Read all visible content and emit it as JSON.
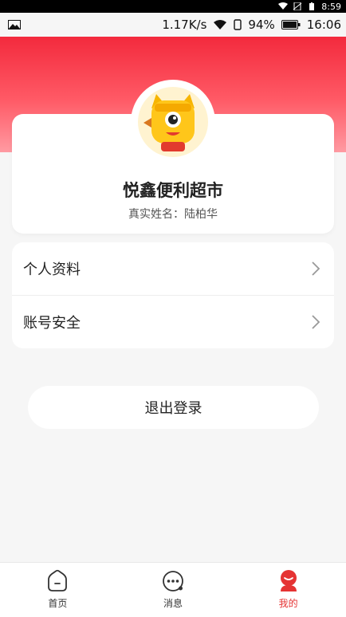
{
  "status_bar": {
    "time": "8:59"
  },
  "app_bar": {
    "speed": "1.17K/s",
    "battery": "94%",
    "time": "16:06"
  },
  "profile": {
    "shop_name": "悦鑫便利超市",
    "real_name_label": "真实姓名：",
    "real_name": "陆柏华"
  },
  "menu": {
    "items": [
      {
        "label": "个人资料"
      },
      {
        "label": "账号安全"
      }
    ]
  },
  "logout_label": "退出登录",
  "tabs": [
    {
      "label": "首页",
      "icon": "home-icon",
      "active": false
    },
    {
      "label": "消息",
      "icon": "message-icon",
      "active": false
    },
    {
      "label": "我的",
      "icon": "profile-icon",
      "active": true
    }
  ],
  "colors": {
    "accent": "#e53333",
    "hero": "#f32a3d"
  }
}
